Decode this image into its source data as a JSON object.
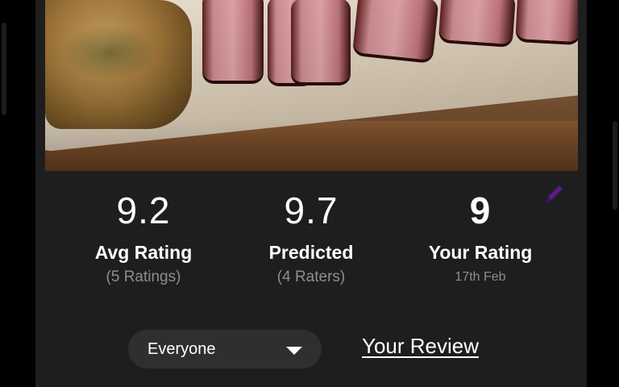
{
  "stats": {
    "avg": {
      "value": "9.2",
      "label": "Avg Rating",
      "sub": "(5 Ratings)"
    },
    "predicted": {
      "value": "9.7",
      "label": "Predicted",
      "sub": "(4 Raters)"
    },
    "yours": {
      "value": "9",
      "label": "Your Rating",
      "sub": "17th Feb"
    }
  },
  "audience_dropdown": {
    "selected": "Everyone"
  },
  "review_link": {
    "label": "Your Review"
  },
  "icons": {
    "edit": "pencil-icon",
    "dropdown": "caret-down-icon"
  },
  "colors": {
    "background": "#1e1e1f",
    "text": "#ffffff",
    "muted": "#8e8e8e",
    "accent": "#5b1a8c",
    "dropdown_bg": "#2f2f30"
  }
}
